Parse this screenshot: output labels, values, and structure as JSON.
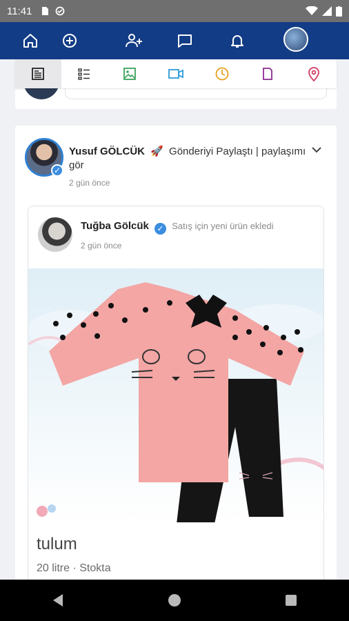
{
  "status_bar": {
    "time": "11:41"
  },
  "nav": {
    "items": [
      {
        "icon": "home-icon"
      },
      {
        "icon": "add-circle-icon"
      },
      {
        "icon": "add-friend-icon"
      },
      {
        "icon": "messages-icon"
      },
      {
        "icon": "bell-icon"
      }
    ],
    "accent": "#123c86"
  },
  "tabs": [
    {
      "icon": "article-icon"
    },
    {
      "icon": "list-icon"
    },
    {
      "icon": "image-icon"
    },
    {
      "icon": "video-icon"
    },
    {
      "icon": "poll-icon"
    },
    {
      "icon": "document-icon"
    },
    {
      "icon": "location-icon"
    }
  ],
  "post": {
    "author": "Yusuf GÖLCÜK",
    "action": "Gönderiyi Paylaştı | paylaşımı gör",
    "time": "2 gün önce",
    "shared": {
      "author": "Tuğba Gölcük",
      "action": "Satış için yeni ürün ekledi",
      "time": "2 gün önce",
      "product_title": "tulum",
      "product_meta": "20 litre  ·  Stokta"
    }
  }
}
